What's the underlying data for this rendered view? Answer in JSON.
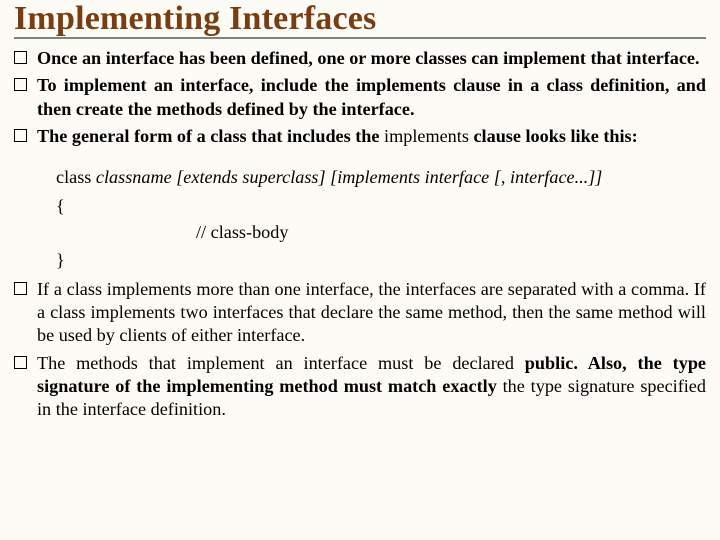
{
  "title": "Implementing Interfaces",
  "top_bullets": [
    "Once an interface has been defined, one or more classes can implement that interface.",
    "To implement an interface, include the implements clause in a class definition, and then create the methods defined by the interface.",
    ""
  ],
  "b3_part1": "The general form of a class that includes the ",
  "b3_kw": "implements",
  "b3_part2": " clause looks like this:",
  "code": {
    "kw_class": "class",
    "signature": " classname [extends superclass] [implements interface [, interface...]]",
    "open": "{",
    "body": "// class-body",
    "close": "}"
  },
  "bottom_bullets": {
    "b4": "   If a class implements more than one interface, the interfaces are separated with a comma. If a class implements two interfaces that declare the same method, then the same method will be used by clients of either interface.",
    "b5_a": "The methods that implement an interface must be declared ",
    "b5_b": "public.",
    "b5_c": " Also, the type signature of the implementing method must match exactly ",
    "b5_d": "the type signature specified in the interface definition."
  }
}
